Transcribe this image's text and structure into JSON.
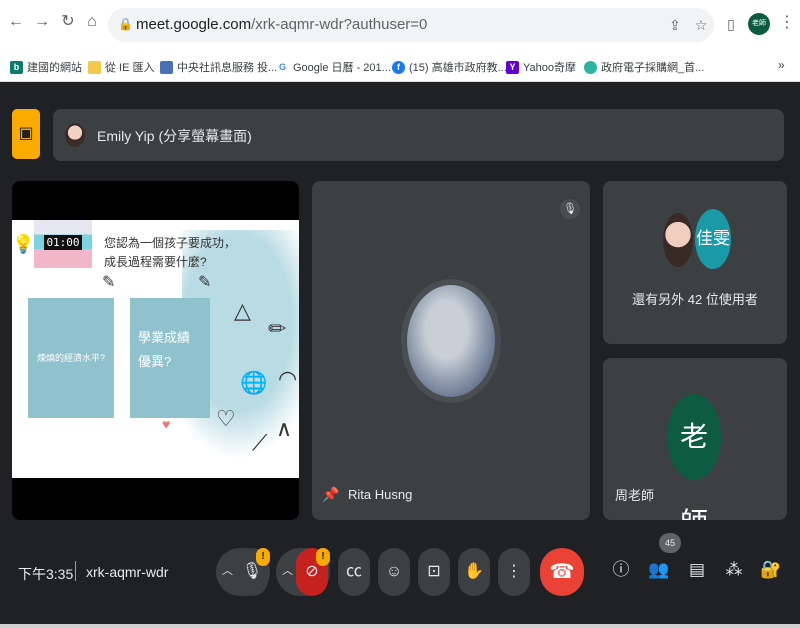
{
  "browser": {
    "url_host": "meet.google.com",
    "url_path": "/xrk-aqmr-wdr?authuser=0",
    "profile_initials": "老師",
    "bookmarks": [
      {
        "label": "建國的網站",
        "icon": "bing-icon",
        "color": "#0e7a6b"
      },
      {
        "label": "從 IE 匯入",
        "icon": "folder-icon",
        "color": "#f2c94c"
      },
      {
        "label": "中央社訊息服務 投...",
        "icon": "page-icon",
        "color": "#4a6fb5"
      },
      {
        "label": "Google 日曆 - 201...",
        "icon": "google-icon",
        "color": "#4285f4"
      },
      {
        "label": "(15) 高雄市政府教...",
        "icon": "facebook-icon",
        "color": "#1877f2"
      },
      {
        "label": "Yahoo奇摩",
        "icon": "yahoo-icon",
        "color": "#6001d2"
      },
      {
        "label": "政府電子採購網_首...",
        "icon": "gov-icon",
        "color": "#2bb3a3"
      }
    ],
    "more_label": "»"
  },
  "meet": {
    "presenter_label": "Emily Yip (分享螢幕畫面)",
    "slide": {
      "timer": "01:00",
      "question": "您認為一個孩子要成功，成長過程需要什麼?",
      "card1": "煉燒的經濟水平?",
      "card2": "學業成績優異?"
    },
    "participant_name": "Rita Husng",
    "others_avatar_text": "佳雯",
    "others_text": "還有另外 42 位使用者",
    "teacher_avatar_text": "老師",
    "teacher_name": "周老師",
    "time": "下午3:35",
    "meeting_code": "xrk-aqmr-wdr",
    "people_count": "45",
    "badge_mark": "!"
  }
}
